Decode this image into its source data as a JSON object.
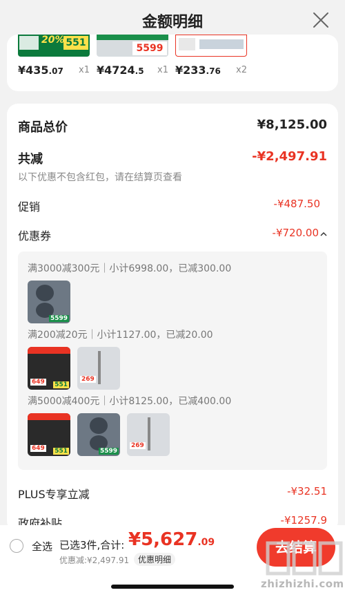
{
  "header": {
    "title": "金额明细",
    "close_icon": "close-icon"
  },
  "products": [
    {
      "price_main": "¥435",
      "price_dec": ".07",
      "qty": "x1"
    },
    {
      "price_main": "¥4724",
      "price_dec": ".5",
      "qty": "x1"
    },
    {
      "price_main": "¥233",
      "price_dec": ".76",
      "qty": "x2"
    }
  ],
  "product_thumb_text": {
    "p1_badge": "20%",
    "p1_num": "551",
    "p2_num": "5599"
  },
  "summary": {
    "total_label": "商品总价",
    "total_value": "¥8,125.00",
    "reduce_label": "共减",
    "reduce_value": "-¥2,497.91",
    "note": "以下优惠不包含红包，请在结算页查看",
    "promo_label": "促销",
    "promo_value": "-¥487.50",
    "coupon_label": "优惠券",
    "coupon_value": "-¥720.00",
    "plus_label": "PLUS专享立减",
    "plus_value": "-¥32.51",
    "gov_label": "政府补贴",
    "gov_value": "-¥1257.9"
  },
  "coupons": [
    {
      "rule": "满3000减300元｜小计6998.00，已减300.00"
    },
    {
      "rule": "满200减20元｜小计1127.00，已减20.00"
    },
    {
      "rule": "满5000减400元｜小计8125.00，已减400.00"
    }
  ],
  "thumb_prices": {
    "washer": "5599",
    "stove": "649",
    "stove_tag": "551",
    "vacuum": "269"
  },
  "bottom": {
    "select_all": "全选",
    "selected": "已选3件,合计:",
    "total_main": "¥5,627",
    "total_dec": ".09",
    "discount": "优惠减:¥2,497.91",
    "detail_link": "优惠明细",
    "checkout": "去结算"
  },
  "watermark": "zhizhizhi.com",
  "colors": {
    "accent": "#e93323",
    "checkout_bg": "#f03b2c",
    "bg": "#f2f2f2"
  }
}
